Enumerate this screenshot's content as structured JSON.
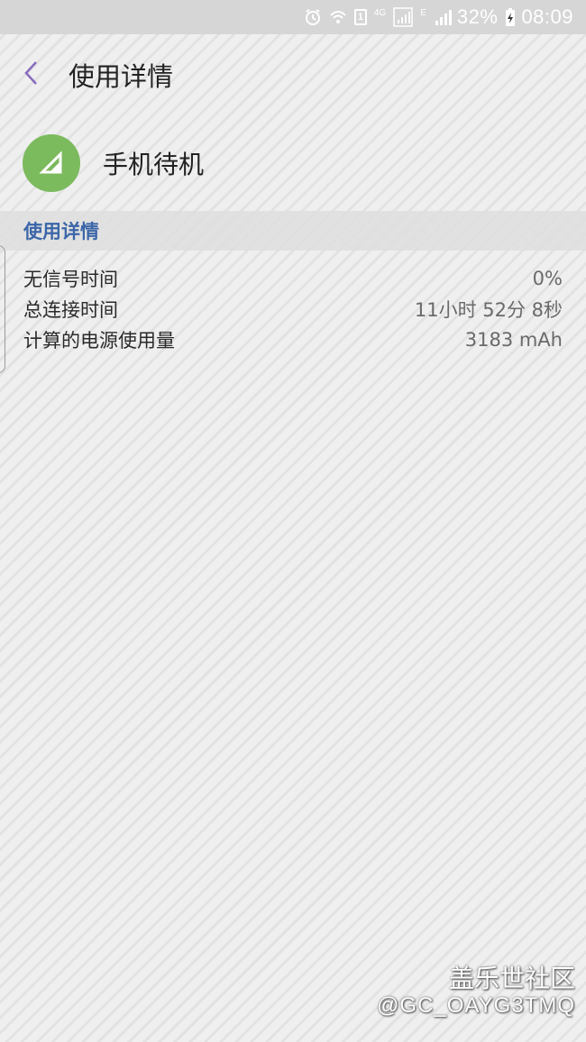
{
  "status_bar": {
    "network_4g": "4G",
    "network_e": "E",
    "sim_slot": "1",
    "battery_percent": "32%",
    "time": "08:09"
  },
  "header": {
    "title": "使用详情"
  },
  "app": {
    "name": "手机待机",
    "icon_color": "#7cba5e"
  },
  "section": {
    "title": "使用详情"
  },
  "details": [
    {
      "label": "无信号时间",
      "value": "0%"
    },
    {
      "label": "总连接时间",
      "value": "11小时 52分 8秒"
    },
    {
      "label": "计算的电源使用量",
      "value": "3183 mAh"
    }
  ],
  "watermark": {
    "line1": "盖乐世社区",
    "line2": "@GC_OAYG3TMQ"
  },
  "colors": {
    "accent_back": "#8a6bbf",
    "section_title": "#3b66a8"
  }
}
